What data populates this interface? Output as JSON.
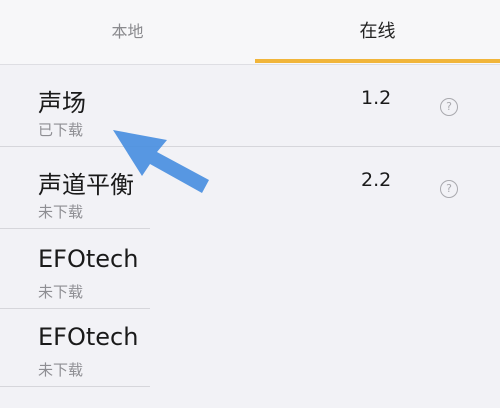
{
  "tabs": {
    "local_label": "本地",
    "online_label": "在线",
    "active": "online"
  },
  "items": [
    {
      "title": "声场",
      "status": "已下载",
      "version": "1.2",
      "help_glyph": "?"
    },
    {
      "title": "声道平衡",
      "status": "未下载",
      "version": "2.2",
      "help_glyph": "?"
    },
    {
      "title": "EFOtech",
      "status": "未下载"
    },
    {
      "title": "EFOtech",
      "status": "未下载"
    }
  ],
  "icons": {
    "help": "help-circle-icon",
    "annotation": "arrow-annotation-icon"
  },
  "colors": {
    "accent": "#f1b53a",
    "annotation_arrow": "#4a8fe0",
    "background": "#f2f2f6"
  }
}
